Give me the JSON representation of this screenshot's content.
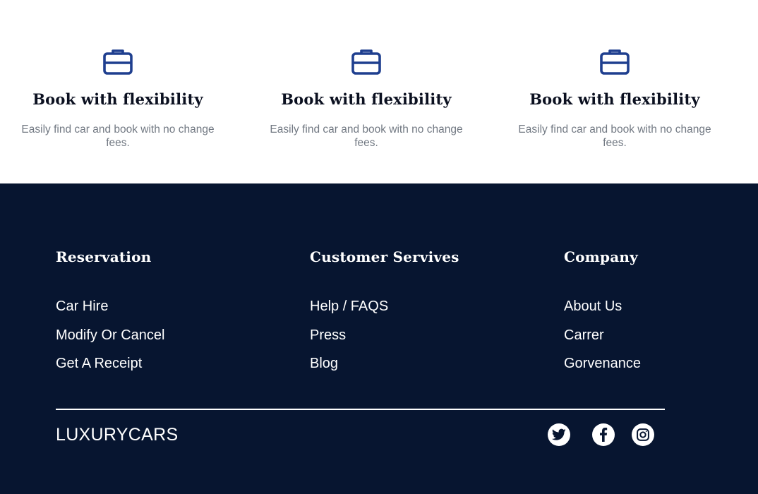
{
  "features": [
    {
      "title": "Book with flexibility",
      "desc_line1": "Easily find car and book with no change",
      "desc_line2": "fees.",
      "icon": "briefcase-icon"
    },
    {
      "title": "Book with flexibility",
      "desc_line1": "Easily find car and book with no change",
      "desc_line2": "fees.",
      "icon": "briefcase-icon"
    },
    {
      "title": "Book with flexibility",
      "desc_line1": "Easily find car and book with no change",
      "desc_line2": "fees.",
      "icon": "briefcase-icon"
    }
  ],
  "footer": {
    "columns": [
      {
        "heading": "Reservation",
        "links": [
          "Car Hire",
          "Modify Or Cancel",
          "Get A Receipt"
        ]
      },
      {
        "heading": "Customer Servives",
        "links": [
          "Help / FAQS",
          "Press",
          "Blog"
        ]
      },
      {
        "heading": "Company",
        "links": [
          "About Us",
          "Carrer",
          "Gorvenance"
        ]
      }
    ],
    "brand": "LUXURYCARS",
    "social": [
      "twitter-icon",
      "facebook-icon",
      "instagram-icon"
    ]
  },
  "colors": {
    "accent": "#1f3f8f",
    "footer_bg": "#071530",
    "muted_text": "#727983"
  }
}
